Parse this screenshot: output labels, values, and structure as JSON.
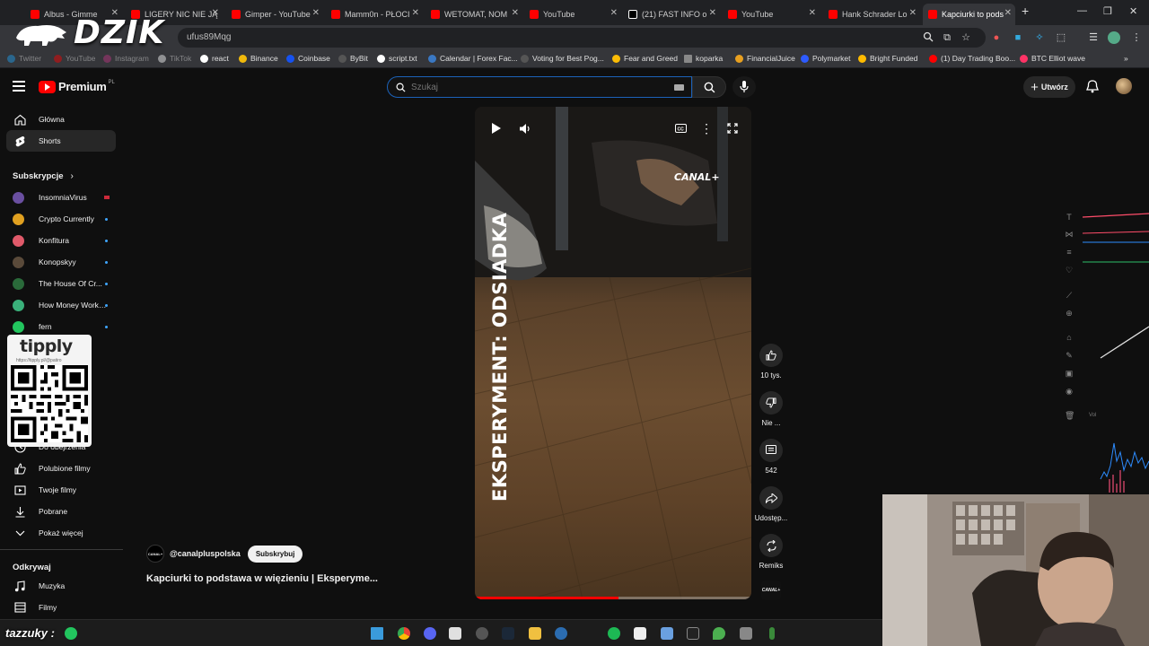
{
  "browser": {
    "tabs": [
      {
        "title": "Albus - Gimme",
        "color": "#ff0000"
      },
      {
        "title": "LIGERY NIC NIE JĄ",
        "color": "#ff0000"
      },
      {
        "title": "Gimper - YouTube",
        "color": "#ff0000"
      },
      {
        "title": "Mamm0n - PŁOCI",
        "color": "#ff0000"
      },
      {
        "title": "WETOMAT, NOM",
        "color": "#ff0000"
      },
      {
        "title": "YouTube",
        "color": "#ff0000"
      },
      {
        "title": "(21) FAST INFO o",
        "color": "#ffffff"
      },
      {
        "title": "YouTube",
        "color": "#ff0000"
      },
      {
        "title": "Hank Schrader Lo",
        "color": "#ff0000"
      },
      {
        "title": "Kapciurki to pods",
        "color": "#ff0000"
      }
    ],
    "new_tab": "+",
    "url": "ufus89Mqg",
    "bookmarks": [
      {
        "label": "Twitter",
        "color": "#1da1f2"
      },
      {
        "label": "YouTube",
        "color": "#ff0000"
      },
      {
        "label": "Instagram",
        "color": "#c13584"
      },
      {
        "label": "TikTok",
        "color": "#ffffff"
      },
      {
        "label": "react",
        "color": "#ffffff"
      },
      {
        "label": "Binance",
        "color": "#f0b90b"
      },
      {
        "label": "Coinbase",
        "color": "#1652f0"
      },
      {
        "label": "ByBit",
        "color": "#222222"
      },
      {
        "label": "script.txt",
        "color": "#ffffff"
      },
      {
        "label": "Calendar | Forex Fac...",
        "color": "#3a78c3"
      },
      {
        "label": "Voting for Best Pog...",
        "color": "#555555"
      },
      {
        "label": "Fear and Greed",
        "color": "#fbbc05"
      },
      {
        "label": "koparka",
        "color": "#888888"
      },
      {
        "label": "FinancialJuice",
        "color": "#e8a020"
      },
      {
        "label": "Polymarket",
        "color": "#2d5bff"
      },
      {
        "label": "Bright Funded",
        "color": "#ffbb00"
      },
      {
        "label": "(1) Day Trading Boo...",
        "color": "#ff0000"
      },
      {
        "label": "BTC Elliot wave",
        "color": "#ff3366"
      }
    ]
  },
  "overlay": {
    "dzik_logo": "DZIK",
    "tipply_title": "tipply",
    "tipply_url": "https://tipply.pl/@patiro",
    "streamer_name": "tazzuky :"
  },
  "youtube": {
    "logo_text": "Premium",
    "logo_sup": "PL",
    "search_placeholder": "Szukaj",
    "create_label": "Utwórz",
    "sidebar": {
      "home": "Główna",
      "shorts": "Shorts",
      "subscriptions_header": "Subskrypcje",
      "subscriptions": [
        {
          "name": "InsomniaVirus",
          "color": "#6a4fa0",
          "live": true
        },
        {
          "name": "Crypto Currently",
          "color": "#e0a020",
          "live": false
        },
        {
          "name": "Konfitura",
          "color": "#e05a6a",
          "live": false
        },
        {
          "name": "Konopskyy",
          "color": "#5a4a3a",
          "live": false
        },
        {
          "name": "The House Of Cr...",
          "color": "#2a6a3a",
          "live": false
        },
        {
          "name": "How Money Works ...",
          "color": "#3ab07a",
          "live": false
        },
        {
          "name": "fern",
          "color": "#22c55e",
          "live": false
        }
      ],
      "you_items": [
        "Do obejrzenia",
        "Polubione filmy",
        "Twoje filmy",
        "Pobrane",
        "Pokaż więcej"
      ],
      "explore_header": "Odkrywaj",
      "explore_items": [
        "Muzyka",
        "Filmy"
      ]
    },
    "short": {
      "overlay_title": "EKSPERYMENT: ODSIADKA",
      "brand": "CANAL+",
      "channel_handle": "@canalpluspolska",
      "subscribe_label": "Subskrybuj",
      "title": "Kapciurki to podstawa w więzieniu | Eksperyme...",
      "progress": 0.52,
      "actions": {
        "likes": "10 tys.",
        "dislike": "Nie ...",
        "comments": "542",
        "share": "Udostęp...",
        "remix": "Remiks"
      },
      "channel_thumb": "CANAL+"
    }
  }
}
